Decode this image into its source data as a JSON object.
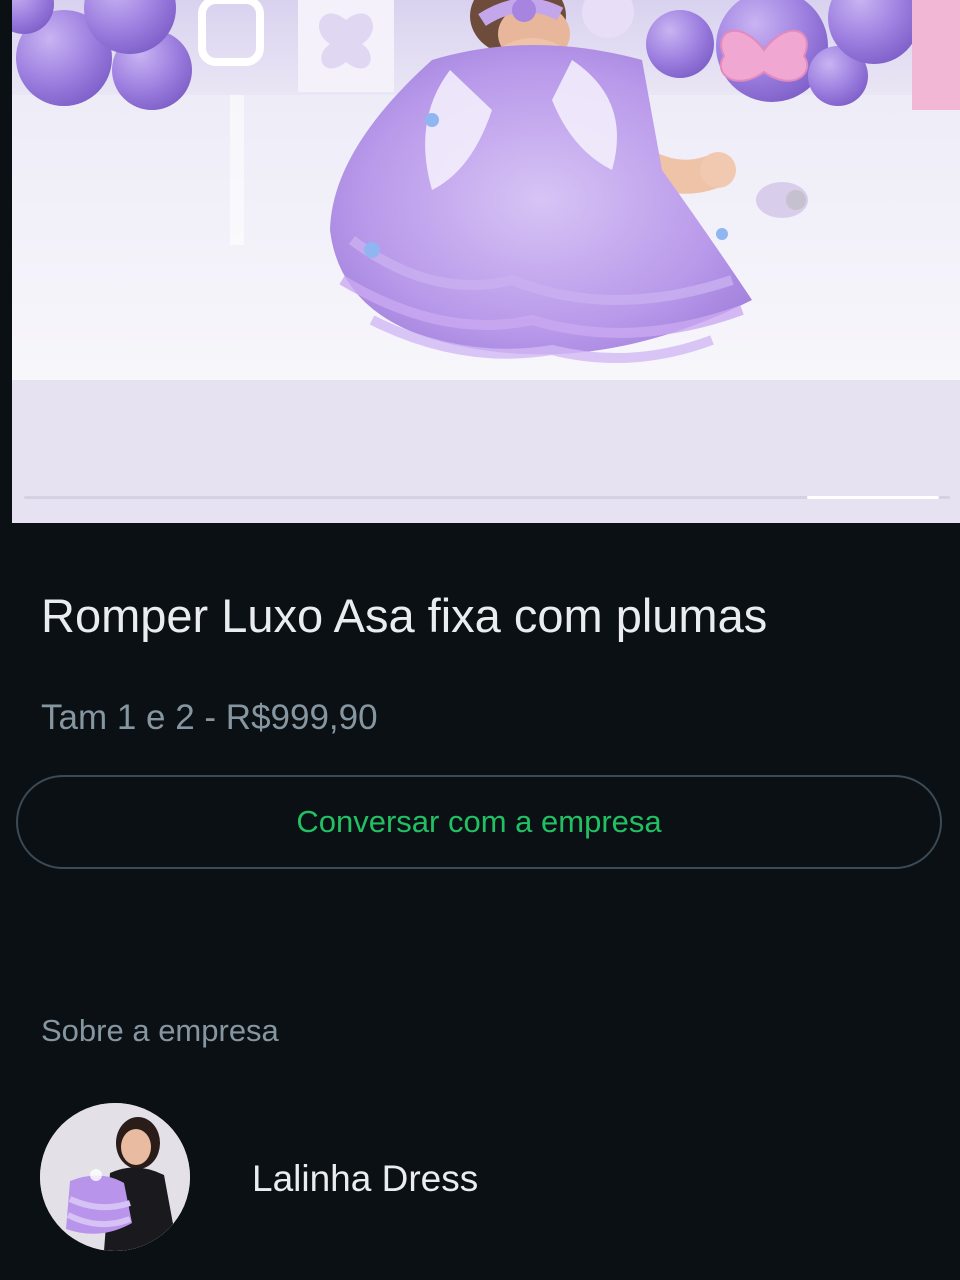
{
  "product": {
    "image_alt": "",
    "title": "Romper Luxo Asa fixa com plumas",
    "price_line": "Tam 1 e 2 - R$999,90",
    "carousel": {
      "total": 7,
      "current": 7
    }
  },
  "actions": {
    "chat_label": "Conversar com a empresa"
  },
  "about": {
    "section_label": "Sobre a empresa",
    "business_name": "Lalinha Dress"
  },
  "colors": {
    "background": "#0b1014",
    "accent": "#21c063",
    "primary_text": "#e9edef",
    "secondary_text": "#8696a0",
    "button_border": "#3b4a54",
    "dress_lilac": "#b89ae6"
  },
  "icons": {
    "avatar": "business-avatar-photo",
    "product_image": "product-photo"
  }
}
